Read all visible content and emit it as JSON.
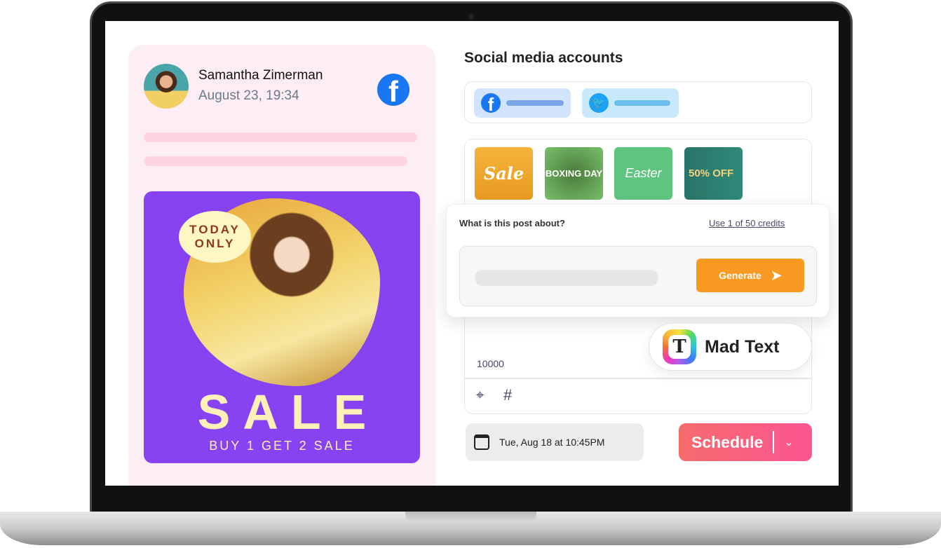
{
  "post": {
    "author": "Samantha Zimerman",
    "timestamp": "August 23, 19:34",
    "network_icon": "facebook-icon",
    "image": {
      "badge_line1": "TODAY",
      "badge_line2": "ONLY",
      "headline": "SALE",
      "subline": "BUY 1 GET 2 SALE"
    }
  },
  "accounts": {
    "title": "Social media accounts",
    "items": [
      {
        "icon": "facebook-icon",
        "color": "#1877f2"
      },
      {
        "icon": "twitter-icon",
        "color": "#1da1f2"
      }
    ]
  },
  "templates": [
    {
      "label": "Sale"
    },
    {
      "label": "BOXING DAY"
    },
    {
      "label": "Easter"
    },
    {
      "label": "50% OFF"
    }
  ],
  "ai_popup": {
    "question": "What is this post about?",
    "credits_link": "Use 1 of 50 credits",
    "generate_label": "Generate"
  },
  "editor": {
    "char_limit": "10000",
    "brand": "Mad Text",
    "brand_letter": "T"
  },
  "schedule": {
    "date_value": "Tue, Aug 18 at 10:45PM",
    "button_label": "Schedule"
  },
  "colors": {
    "accent_orange": "#fb9a22",
    "schedule_start": "#f56c6c",
    "schedule_end": "#fc5593",
    "poster_purple": "#8743f2",
    "card_pink": "#fdeef5"
  }
}
